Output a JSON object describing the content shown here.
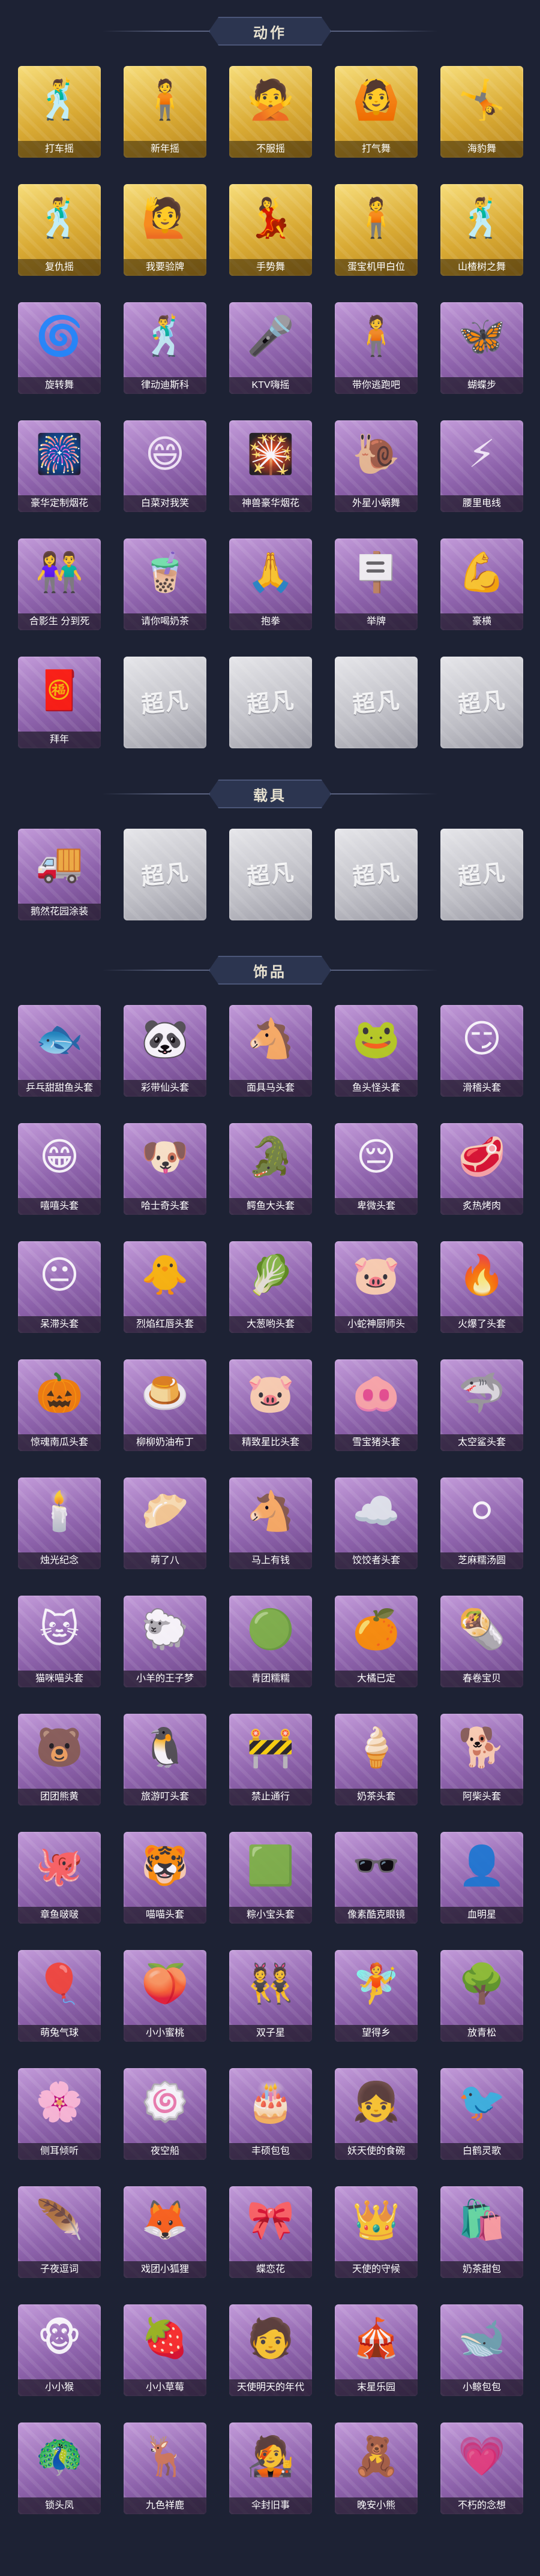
{
  "sections": {
    "actions": {
      "title": "动作",
      "items": [
        {
          "label": "打车摇",
          "style": "gold",
          "icon": "🕺"
        },
        {
          "label": "新年摇",
          "style": "gold",
          "icon": "🧍"
        },
        {
          "label": "不服摇",
          "style": "gold",
          "icon": "🙅"
        },
        {
          "label": "打气舞",
          "style": "gold",
          "icon": "🙆"
        },
        {
          "label": "海豹舞",
          "style": "gold",
          "icon": "🤸"
        },
        {
          "label": "复仇摇",
          "style": "gold",
          "icon": "🕺"
        },
        {
          "label": "我要验牌",
          "style": "gold",
          "icon": "🙋"
        },
        {
          "label": "手势舞",
          "style": "gold",
          "icon": "💃"
        },
        {
          "label": "蛋宝机甲白位",
          "style": "gold",
          "icon": "🧍"
        },
        {
          "label": "山楂树之舞",
          "style": "gold",
          "icon": "🕺"
        },
        {
          "label": "旋转舞",
          "style": "purple",
          "icon": "🌀"
        },
        {
          "label": "律动迪斯科",
          "style": "purple",
          "icon": "🕺"
        },
        {
          "label": "KTV嗨摇",
          "style": "purple",
          "icon": "🎤"
        },
        {
          "label": "带你逃跑吧",
          "style": "purple",
          "icon": "🧍"
        },
        {
          "label": "蝴蝶步",
          "style": "purple",
          "icon": "🦋"
        },
        {
          "label": "豪华定制烟花",
          "style": "purple",
          "icon": "🎆"
        },
        {
          "label": "白菜对我笑",
          "style": "purple",
          "icon": "😄"
        },
        {
          "label": "神兽豪华烟花",
          "style": "purple",
          "icon": "🎇"
        },
        {
          "label": "外星小蜗舞",
          "style": "purple",
          "icon": "🐌"
        },
        {
          "label": "腰里电线",
          "style": "purple",
          "icon": "⚡"
        },
        {
          "label": "合影生 分到死",
          "style": "purple",
          "icon": "👫"
        },
        {
          "label": "请你喝奶茶",
          "style": "purple",
          "icon": "🧋"
        },
        {
          "label": "抱拳",
          "style": "purple",
          "icon": "🙏"
        },
        {
          "label": "举牌",
          "style": "purple",
          "icon": "🪧"
        },
        {
          "label": "豪横",
          "style": "purple",
          "icon": "💪"
        },
        {
          "label": "拜年",
          "style": "purple",
          "icon": "🧧"
        },
        {
          "label": "",
          "style": "grey",
          "watermark": "超凡"
        },
        {
          "label": "",
          "style": "grey",
          "watermark": "超凡"
        },
        {
          "label": "",
          "style": "grey",
          "watermark": "超凡"
        },
        {
          "label": "",
          "style": "grey",
          "watermark": "超凡"
        }
      ]
    },
    "vehicles": {
      "title": "载具",
      "items": [
        {
          "label": "鹅然花园涂装",
          "style": "purple",
          "icon": "🚚"
        },
        {
          "label": "",
          "style": "grey",
          "watermark": "超凡"
        },
        {
          "label": "",
          "style": "grey",
          "watermark": "超凡"
        },
        {
          "label": "",
          "style": "grey",
          "watermark": "超凡"
        },
        {
          "label": "",
          "style": "grey",
          "watermark": "超凡"
        }
      ]
    },
    "accessories": {
      "title": "饰品",
      "items": [
        {
          "label": "乒乓甜甜鱼头套",
          "style": "purple",
          "icon": "🐟"
        },
        {
          "label": "彩带仙头套",
          "style": "purple",
          "icon": "🐼"
        },
        {
          "label": "面具马头套",
          "style": "purple",
          "icon": "🐴"
        },
        {
          "label": "鱼头怪头套",
          "style": "purple",
          "icon": "🐸"
        },
        {
          "label": "滑稽头套",
          "style": "purple",
          "icon": "😏"
        },
        {
          "label": "嘻嘻头套",
          "style": "purple",
          "icon": "😁"
        },
        {
          "label": "哈士奇头套",
          "style": "purple",
          "icon": "🐶"
        },
        {
          "label": "鳄鱼大头套",
          "style": "purple",
          "icon": "🐊"
        },
        {
          "label": "卑微头套",
          "style": "purple",
          "icon": "😔"
        },
        {
          "label": "炙热烤肉",
          "style": "purple",
          "icon": "🥩"
        },
        {
          "label": "呆滞头套",
          "style": "purple",
          "icon": "😐"
        },
        {
          "label": "烈焰红唇头套",
          "style": "purple",
          "icon": "🐥"
        },
        {
          "label": "大葱哟头套",
          "style": "purple",
          "icon": "🥬"
        },
        {
          "label": "小蛇神厨师头",
          "style": "purple",
          "icon": "🐷"
        },
        {
          "label": "火爆了头套",
          "style": "purple",
          "icon": "🔥"
        },
        {
          "label": "惊魂南瓜头套",
          "style": "purple",
          "icon": "🎃"
        },
        {
          "label": "柳柳奶油布丁",
          "style": "purple",
          "icon": "🍮"
        },
        {
          "label": "精致星比头套",
          "style": "purple",
          "icon": "🐷"
        },
        {
          "label": "雪宝猪头套",
          "style": "purple",
          "icon": "🐽"
        },
        {
          "label": "太空鲨头套",
          "style": "purple",
          "icon": "🦈"
        },
        {
          "label": "烛光纪念",
          "style": "purple",
          "icon": "🕯️"
        },
        {
          "label": "萌了八",
          "style": "purple",
          "icon": "🥟"
        },
        {
          "label": "马上有钱",
          "style": "purple",
          "icon": "🐴"
        },
        {
          "label": "饺饺者头套",
          "style": "purple",
          "icon": "☁️"
        },
        {
          "label": "芝麻糯汤圆",
          "style": "purple",
          "icon": "⚪"
        },
        {
          "label": "猫咪喵头套",
          "style": "purple",
          "icon": "🐱"
        },
        {
          "label": "小羊的王子梦",
          "style": "purple",
          "icon": "🐑"
        },
        {
          "label": "青团糯糯",
          "style": "purple",
          "icon": "🟢"
        },
        {
          "label": "大橘已定",
          "style": "purple",
          "icon": "🍊"
        },
        {
          "label": "春卷宝贝",
          "style": "purple",
          "icon": "🌯"
        },
        {
          "label": "团团熊黄",
          "style": "purple",
          "icon": "🐻"
        },
        {
          "label": "旅游叮头套",
          "style": "purple",
          "icon": "🐧"
        },
        {
          "label": "禁止通行",
          "style": "purple",
          "icon": "🚧"
        },
        {
          "label": "奶茶头套",
          "style": "purple",
          "icon": "🍦"
        },
        {
          "label": "阿柴头套",
          "style": "purple",
          "icon": "🐕"
        },
        {
          "label": "章鱼啵啵",
          "style": "purple",
          "icon": "🐙"
        },
        {
          "label": "喵喵头套",
          "style": "purple",
          "icon": "🐯"
        },
        {
          "label": "粽小宝头套",
          "style": "purple",
          "icon": "🟩"
        },
        {
          "label": "像素酷克眼镜",
          "style": "purple",
          "icon": "🕶️"
        },
        {
          "label": "血明星",
          "style": "purple",
          "icon": "👤"
        },
        {
          "label": "萌兔气球",
          "style": "purple",
          "icon": "🎈"
        },
        {
          "label": "小小蜜桃",
          "style": "purple",
          "icon": "🍑"
        },
        {
          "label": "双子星",
          "style": "purple",
          "icon": "👯"
        },
        {
          "label": "望得乡",
          "style": "purple",
          "icon": "🧚"
        },
        {
          "label": "放青松",
          "style": "purple",
          "icon": "🌳"
        },
        {
          "label": "侧耳倾听",
          "style": "purple",
          "icon": "🌸"
        },
        {
          "label": "夜空船",
          "style": "purple",
          "icon": "🍥"
        },
        {
          "label": "丰硕包包",
          "style": "purple",
          "icon": "🎂"
        },
        {
          "label": "妖天使的食碗",
          "style": "purple",
          "icon": "👧"
        },
        {
          "label": "白鹤灵歌",
          "style": "purple",
          "icon": "🐦"
        },
        {
          "label": "子夜逗词",
          "style": "purple",
          "icon": "🪶"
        },
        {
          "label": "戏团小狐狸",
          "style": "purple",
          "icon": "🦊"
        },
        {
          "label": "蝶恋花",
          "style": "purple",
          "icon": "🎀"
        },
        {
          "label": "天使的守候",
          "style": "purple",
          "icon": "👑"
        },
        {
          "label": "奶茶甜包",
          "style": "purple",
          "icon": "🛍️"
        },
        {
          "label": "小小猴",
          "style": "purple",
          "icon": "🐵"
        },
        {
          "label": "小小草莓",
          "style": "purple",
          "icon": "🍓"
        },
        {
          "label": "天使明天的年代",
          "style": "purple",
          "icon": "🧑"
        },
        {
          "label": "末星乐园",
          "style": "purple",
          "icon": "🎪"
        },
        {
          "label": "小鲸包包",
          "style": "purple",
          "icon": "🐋"
        },
        {
          "label": "锁头凤",
          "style": "purple",
          "icon": "🦚"
        },
        {
          "label": "九色祥鹿",
          "style": "purple",
          "icon": "🦌"
        },
        {
          "label": "伞封旧事",
          "style": "purple",
          "icon": "🧑‍🎤"
        },
        {
          "label": "晚安小熊",
          "style": "purple",
          "icon": "🧸"
        },
        {
          "label": "不朽的念想",
          "style": "purple",
          "icon": "💗"
        }
      ]
    }
  }
}
